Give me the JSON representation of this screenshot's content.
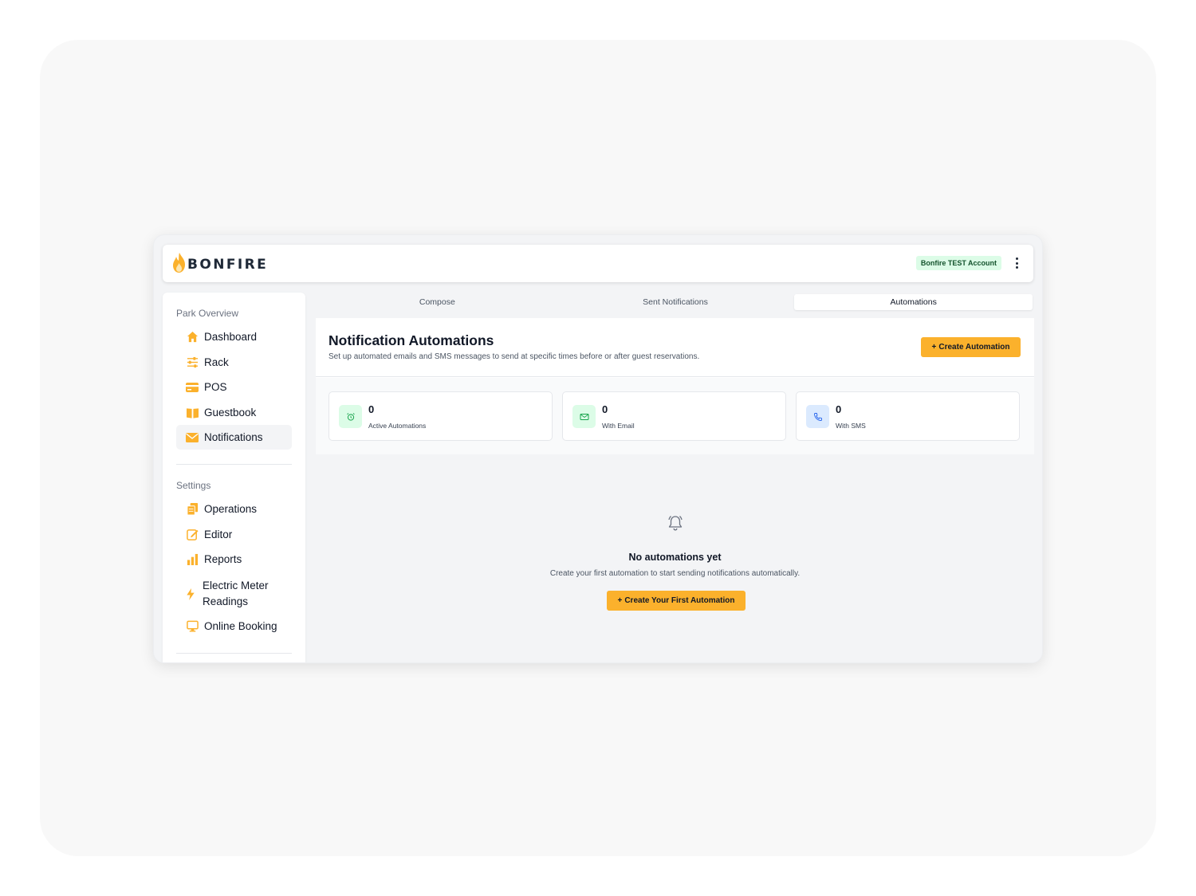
{
  "brand": {
    "name": "BONFIRE",
    "accent": "#fbb12c"
  },
  "header": {
    "account_badge": "Bonfire TEST Account",
    "menu_icon": "kebab-menu-icon"
  },
  "sidebar": {
    "section_park": "Park Overview",
    "park_items": [
      {
        "label": "Dashboard",
        "icon": "home-icon"
      },
      {
        "label": "Rack",
        "icon": "sliders-icon"
      },
      {
        "label": "POS",
        "icon": "credit-card-icon"
      },
      {
        "label": "Guestbook",
        "icon": "book-icon"
      },
      {
        "label": "Notifications",
        "icon": "envelope-icon",
        "active": true
      }
    ],
    "section_settings": "Settings",
    "settings_items": [
      {
        "label": "Operations",
        "icon": "documents-icon"
      },
      {
        "label": "Editor",
        "icon": "edit-icon"
      },
      {
        "label": "Reports",
        "icon": "bar-chart-icon"
      },
      {
        "label": "Electric Meter Readings",
        "line1": "Electric Meter",
        "line2": "Readings",
        "icon": "lightning-icon"
      },
      {
        "label": "Online Booking",
        "icon": "monitor-icon"
      }
    ]
  },
  "tabs": [
    {
      "label": "Compose"
    },
    {
      "label": "Sent Notifications"
    },
    {
      "label": "Automations",
      "active": true
    }
  ],
  "main": {
    "title": "Notification Automations",
    "subtitle": "Set up automated emails and SMS messages to send at specific times before or after guest reservations.",
    "create_button": "Create Automation",
    "stats": [
      {
        "value": "0",
        "label": "Active Automations",
        "icon": "alarm-clock-icon",
        "color": "#dcfce7"
      },
      {
        "value": "0",
        "label": "With Email",
        "icon": "mail-icon",
        "color": "#dcfce7"
      },
      {
        "value": "0",
        "label": "With SMS",
        "icon": "phone-icon",
        "color": "#dbeafe"
      }
    ],
    "empty": {
      "icon": "bell-icon",
      "title": "No automations yet",
      "subtitle": "Create your first automation to start sending notifications automatically.",
      "button": "Create Your First Automation"
    }
  }
}
